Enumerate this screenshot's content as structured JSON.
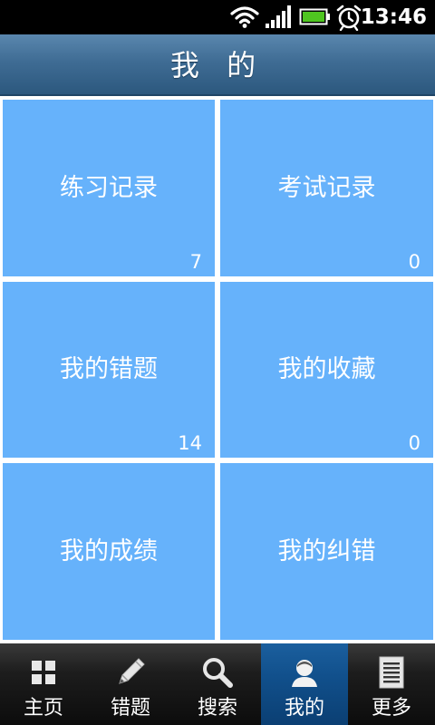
{
  "status_bar": {
    "time": "13:46",
    "icons": [
      "wifi-icon",
      "signal-icon",
      "battery-icon",
      "alarm-icon"
    ],
    "battery_color": "#4fc520"
  },
  "header": {
    "title": "我 的"
  },
  "tiles": [
    {
      "label": "练习记录",
      "count": "7"
    },
    {
      "label": "考试记录",
      "count": "0"
    },
    {
      "label": "我的错题",
      "count": "14"
    },
    {
      "label": "我的收藏",
      "count": "0"
    },
    {
      "label": "我的成绩",
      "count": ""
    },
    {
      "label": "我的纠错",
      "count": ""
    }
  ],
  "bottom_nav": {
    "items": [
      {
        "label": "主页",
        "icon": "grid-icon",
        "active": false
      },
      {
        "label": "错题",
        "icon": "pencil-icon",
        "active": false
      },
      {
        "label": "搜索",
        "icon": "search-icon",
        "active": false
      },
      {
        "label": "我的",
        "icon": "user-icon",
        "active": true
      },
      {
        "label": "更多",
        "icon": "document-icon",
        "active": false
      }
    ]
  },
  "colors": {
    "tile": "#66b2fb",
    "header": "#3f6c94",
    "nav_active": "#11508c"
  }
}
